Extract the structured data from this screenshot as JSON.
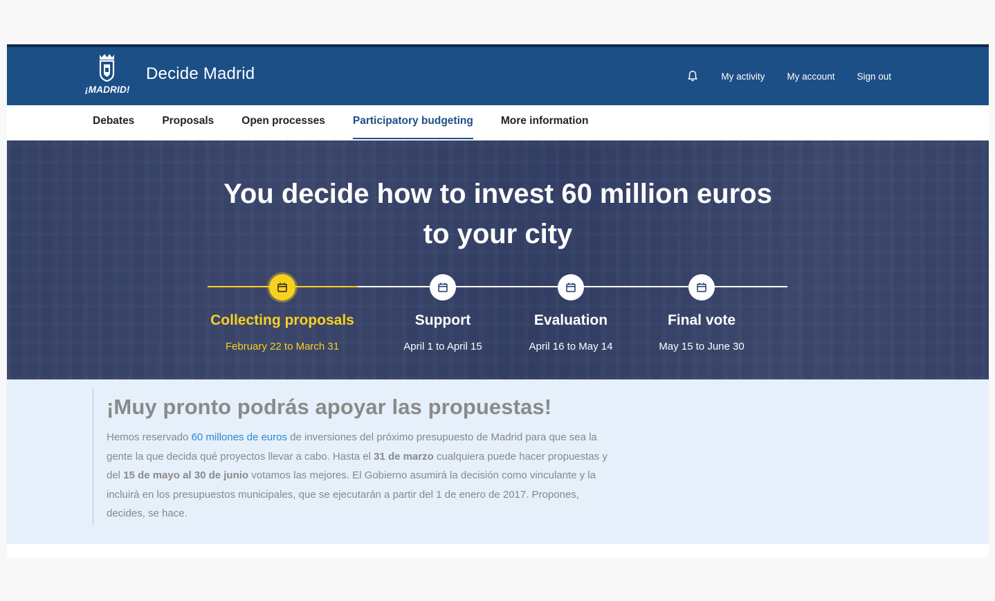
{
  "header": {
    "logo_text": "¡MADRID!",
    "site_title": "Decide Madrid",
    "nav": {
      "my_activity": "My activity",
      "my_account": "My account",
      "sign_out": "Sign out"
    }
  },
  "menu": {
    "items": [
      {
        "label": "Debates"
      },
      {
        "label": "Proposals"
      },
      {
        "label": "Open processes"
      },
      {
        "label": "Participatory budgeting",
        "active": true
      },
      {
        "label": "More information"
      }
    ]
  },
  "hero": {
    "title_line1": "You decide how to invest 60 million euros",
    "title_line2": "to your city",
    "phases": [
      {
        "name": "Collecting proposals",
        "dates": "February 22 to March 31",
        "active": true
      },
      {
        "name": "Support",
        "dates": "April 1 to April 15",
        "active": false
      },
      {
        "name": "Evaluation",
        "dates": "April 16 to May 14",
        "active": false
      },
      {
        "name": "Final vote",
        "dates": "May 15 to June 30",
        "active": false
      }
    ]
  },
  "announcement": {
    "heading": "¡Muy pronto podrás apoyar las propuestas!",
    "text_1": "Hemos reservado ",
    "link": "60 millones de euros",
    "text_2": " de inversiones del próximo presupuesto de Madrid para que sea la gente la que decida qué proyectos llevar a cabo. Hasta el ",
    "bold_1": "31 de marzo",
    "text_3": " cualquiera puede hacer propuestas y del ",
    "bold_2": "15 de mayo al 30 de junio",
    "text_4": " votamos las mejores. El Gobierno asumirá la decisión como vinculante y la incluirá en los presupuestos municipales, que se ejecutarán a partir del 1 de enero de 2017. Propones, decides, se hace."
  },
  "colors": {
    "header_blue": "#1c4f86",
    "accent_yellow": "#f9d11f",
    "link_blue": "#2f88d4",
    "announce_bg": "#e6f0fa"
  },
  "icons": {
    "notifications": "bell-icon",
    "phase": "calendar-icon"
  }
}
